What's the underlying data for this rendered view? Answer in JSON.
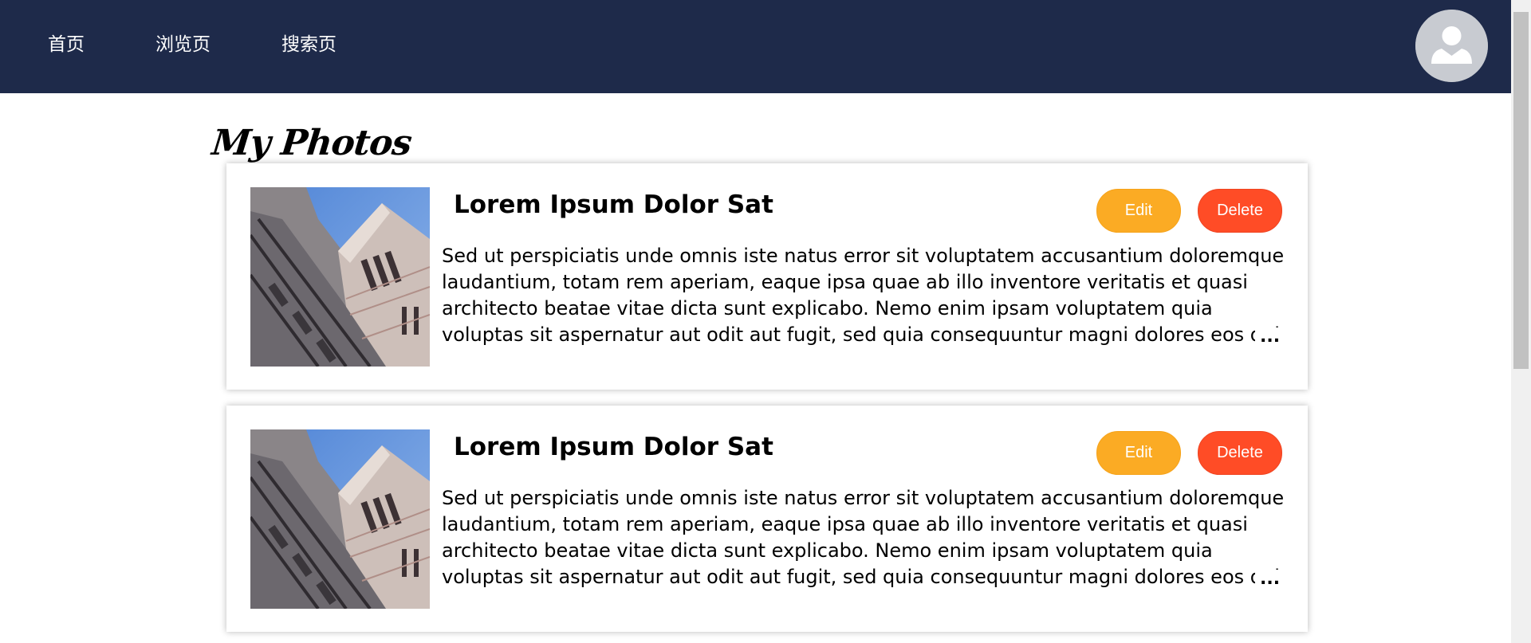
{
  "nav": {
    "items": [
      {
        "label": "首页"
      },
      {
        "label": "浏览页"
      },
      {
        "label": "搜索页"
      }
    ],
    "avatar_icon": "user-avatar-icon"
  },
  "page": {
    "title": "My Photos"
  },
  "photos": [
    {
      "title": "Lorem Ipsum Dolor Sat",
      "description": "Sed ut perspiciatis unde omnis iste natus error sit voluptatem accusantium doloremque laudantium, totam rem aperiam, eaque ipsa quae ab illo inventore veritatis et quasi architecto beatae vitae dicta sunt explicabo. Nemo enim ipsam voluptatem quia voluptas sit aspernatur aut odit aut fugit, sed quia consequuntur magni dolores eos qui ratione",
      "more": "...",
      "edit_label": "Edit",
      "delete_label": "Delete"
    },
    {
      "title": "Lorem Ipsum Dolor Sat",
      "description": "Sed ut perspiciatis unde omnis iste natus error sit voluptatem accusantium doloremque laudantium, totam rem aperiam, eaque ipsa quae ab illo inventore veritatis et quasi architecto beatae vitae dicta sunt explicabo. Nemo enim ipsam voluptatem quia voluptas sit aspernatur aut odit aut fugit, sed quia consequuntur magni dolores eos qui ratione",
      "more": "...",
      "edit_label": "Edit",
      "delete_label": "Delete"
    }
  ],
  "colors": {
    "navbar": "#1e2a4a",
    "edit_button": "#fbab24",
    "delete_button": "#ff4c26"
  }
}
